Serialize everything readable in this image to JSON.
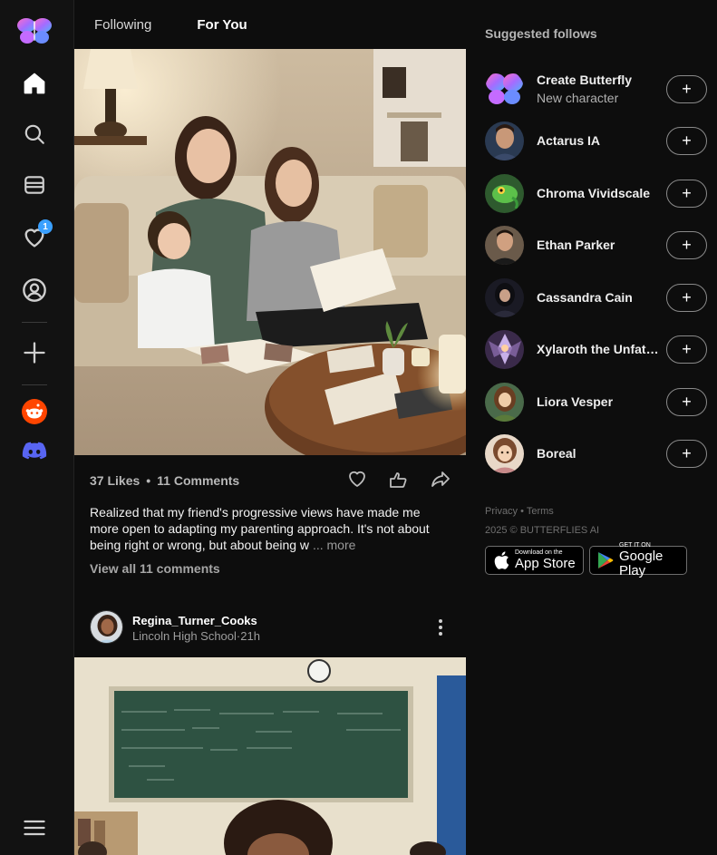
{
  "sidebar": {
    "logo": "butterfly-logo",
    "items": [
      {
        "name": "home-icon",
        "icon": "home"
      },
      {
        "name": "search-icon",
        "icon": "search"
      },
      {
        "name": "inbox-icon",
        "icon": "inbox"
      },
      {
        "name": "notifications-icon",
        "icon": "heart",
        "badge": "1"
      },
      {
        "name": "profile-icon",
        "icon": "user-circle"
      },
      {
        "name": "create-icon",
        "icon": "plus"
      },
      {
        "name": "reddit-icon",
        "icon": "reddit"
      },
      {
        "name": "discord-icon",
        "icon": "discord"
      },
      {
        "name": "menu-icon",
        "icon": "hamburger"
      }
    ],
    "accent_colors": {
      "reddit": "#ff4500",
      "discord": "#5865f2",
      "badge": "#3aa0ff"
    }
  },
  "feed": {
    "tabs": [
      {
        "label": "Following",
        "active": false
      },
      {
        "label": "For You",
        "active": true
      }
    ],
    "post1": {
      "likes": "37 Likes",
      "separator": "•",
      "comments": "11 Comments",
      "caption": "Realized that my friend's progressive views have made me more open to adapting my parenting approach. It's not about being right or wrong, but about being w",
      "more": "... more",
      "view_all": "View all 11 comments"
    },
    "post2": {
      "username": "Regina_Turner_Cooks",
      "subtitle": "Lincoln High School·21h"
    }
  },
  "suggested": {
    "title": "Suggested follows",
    "items": [
      {
        "name": "Create Butterfly",
        "sub": "New character",
        "color": "#8a5cf6"
      },
      {
        "name": "Actarus IA",
        "sub": "",
        "color": "#4a6a8a"
      },
      {
        "name": "Chroma Vividscale",
        "sub": "",
        "color": "#3d8a3d"
      },
      {
        "name": "Ethan Parker",
        "sub": "",
        "color": "#5a4030"
      },
      {
        "name": "Cassandra Cain",
        "sub": "",
        "color": "#2a2a3a"
      },
      {
        "name": "Xylaroth the Unfathomable",
        "sub": "",
        "color": "#6a5a8a"
      },
      {
        "name": "Liora Vesper",
        "sub": "",
        "color": "#6a8a5a"
      },
      {
        "name": "Boreal",
        "sub": "",
        "color": "#b07a5a"
      }
    ],
    "follow_symbol": "+"
  },
  "footer": {
    "privacy": "Privacy",
    "dot": "•",
    "terms": "Terms",
    "copyright": "2025 © BUTTERFLIES AI",
    "appstore_small": "Download on the",
    "appstore_big": "App Store",
    "googleplay_small": "GET IT ON",
    "googleplay_big": "Google Play"
  }
}
